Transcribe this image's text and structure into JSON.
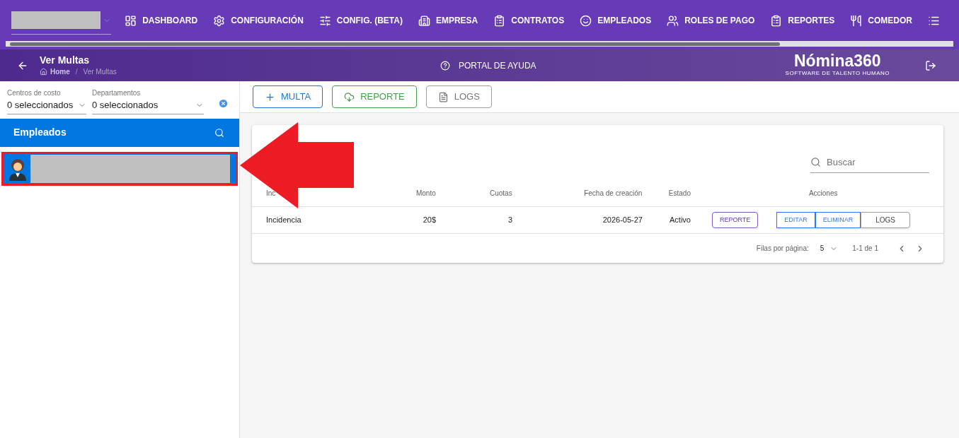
{
  "nav": {
    "items": [
      {
        "label": "DASHBOARD",
        "kind": "dashboard"
      },
      {
        "label": "CONFIGURACIÓN",
        "kind": "gear"
      },
      {
        "label": "CONFIG. (BETA)",
        "kind": "sliders"
      },
      {
        "label": "EMPRESA",
        "kind": "building"
      },
      {
        "label": "CONTRATOS",
        "kind": "clipboard"
      },
      {
        "label": "EMPLEADOS",
        "kind": "face"
      },
      {
        "label": "ROLES DE PAGO",
        "kind": "people"
      },
      {
        "label": "REPORTES",
        "kind": "clipboard"
      },
      {
        "label": "COMEDOR",
        "kind": "utensils"
      },
      {
        "kind": "list"
      }
    ]
  },
  "header": {
    "title": "Ver Multas",
    "breadcrumb": [
      "Home",
      "/",
      "Ver Multas"
    ],
    "help": "PORTAL DE AYUDA",
    "logo": "Nómina360",
    "logo_tagline": "SOFTWARE DE TALENTO HUMANO"
  },
  "filters": [
    {
      "label": "Centros de costo",
      "value": "0 seleccionados"
    },
    {
      "label": "Departamentos",
      "value": "0 seleccionados"
    }
  ],
  "employees": {
    "title": "Empleados",
    "items": [
      {
        "selected": true
      }
    ]
  },
  "toolbar": [
    {
      "label": "MULTA",
      "kind": "add"
    },
    {
      "label": "REPORTE",
      "kind": "download"
    },
    {
      "label": "LOGS",
      "kind": "logs"
    }
  ],
  "table": {
    "search_placeholder": "Buscar",
    "columns": [
      "Inc",
      "Monto",
      "Cuotas",
      "Fecha de creación",
      "Estado",
      "Acciones"
    ],
    "rows": [
      {
        "cells": [
          "Incidencia",
          "20$",
          "3",
          "2026-05-27",
          "Activo"
        ],
        "actions": [
          {
            "label": "REPORTE",
            "kind": "report"
          },
          {
            "label": "EDITAR",
            "kind": "group"
          },
          {
            "label": "ELIMINAR",
            "kind": "group"
          },
          {
            "label": "LOGS",
            "kind": "logs"
          }
        ]
      }
    ],
    "rows_per_page_label": "Filas por página:",
    "rows_per_page": "5",
    "range": "1-1 de 1"
  }
}
